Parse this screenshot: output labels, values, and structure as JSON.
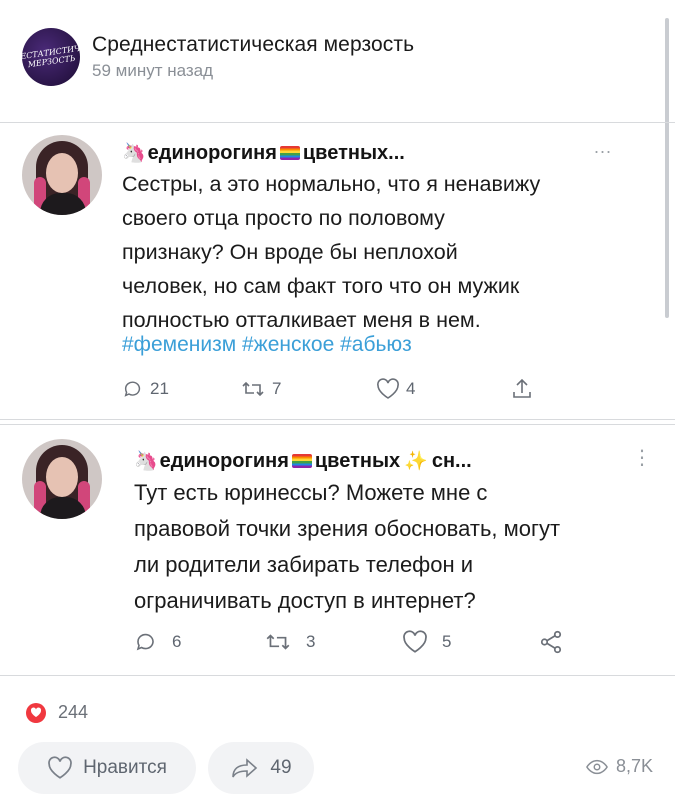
{
  "post": {
    "channel_name": "Среднестатистическая мерзость",
    "time": "59 минут назад",
    "channel_avatar_text": "СРЕДНЕСТАТИСТИЧЕСКАЯ МЕРЗОСТЬ"
  },
  "tweets": [
    {
      "name_prefix_emoji": "🦄",
      "name": "единорогиня",
      "name_suffix": "цветных...",
      "text_lines": [
        "Сестры, а это нормально, что я ненавижу",
        "своего отца просто по половому",
        "признаку? Он вроде бы неплохой",
        "человек, но сам факт того что он мужик",
        "полностью отталкивает меня в нем."
      ],
      "hashtags": "#феменизм #женское #абьюз",
      "replies": "21",
      "retweets": "7",
      "likes": "4",
      "more": "..."
    },
    {
      "name_prefix_emoji": "🦄",
      "name": "единорогиня",
      "name_suffix": "цветных",
      "sparkle": "✨",
      "name_tail": "сн...",
      "text_lines": [
        "Тут есть юринессы? Можете мне с",
        "правовой точки зрения обосновать, могут",
        "ли родители забирать телефон и",
        "ограничивать доступ в интернет?"
      ],
      "replies": "6",
      "retweets": "3",
      "likes": "5",
      "more": "⋮"
    }
  ],
  "footer": {
    "likes_count": "244",
    "like_label": "Нравится",
    "shares": "49",
    "views": "8,7K"
  },
  "colors": {
    "like_red": "#f0383f",
    "hashtag_blue": "#3b9fd8"
  }
}
